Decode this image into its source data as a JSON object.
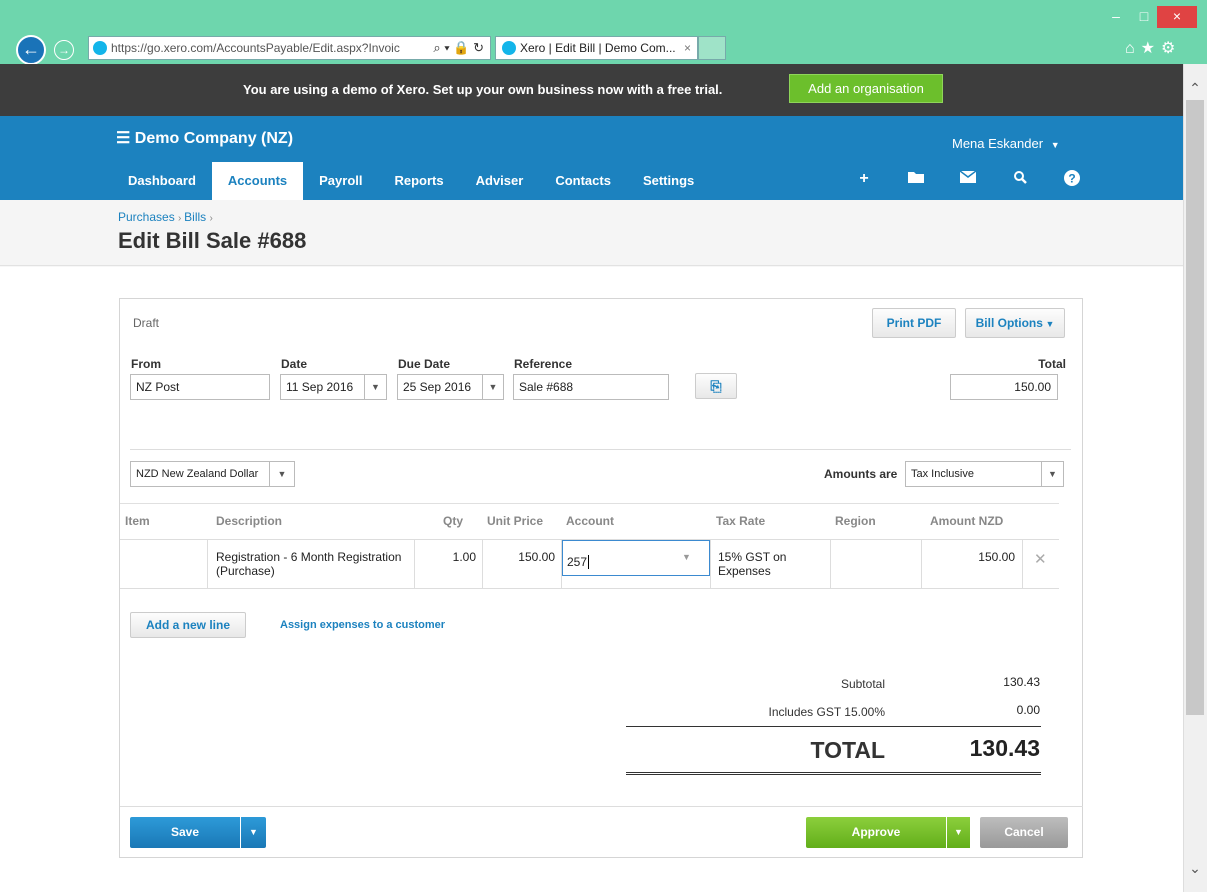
{
  "browser": {
    "url": "https://go.xero.com/AccountsPayable/Edit.aspx?Invoic",
    "tab_title": "Xero | Edit Bill | Demo Com...",
    "tab_close": "×",
    "window_minimize": "–",
    "window_maximize": "□",
    "window_close": "×"
  },
  "banner": {
    "message": "You are using a demo of Xero. Set up your own business now with a free trial.",
    "add_org_label": "Add an organisation"
  },
  "header": {
    "company": "Demo Company (NZ)",
    "user": "Mena Eskander"
  },
  "nav": {
    "items": [
      "Dashboard",
      "Accounts",
      "Payroll",
      "Reports",
      "Adviser",
      "Contacts",
      "Settings"
    ],
    "active": "Accounts",
    "icons": [
      "plus-icon",
      "folder-icon",
      "mail-icon",
      "search-icon",
      "help-icon"
    ]
  },
  "page": {
    "breadcrumb": [
      "Purchases",
      "Bills"
    ],
    "title": "Edit Bill Sale #688"
  },
  "bill": {
    "status": "Draft",
    "print_pdf_label": "Print PDF",
    "bill_options_label": "Bill Options",
    "from_label": "From",
    "from_value": "NZ Post",
    "date_label": "Date",
    "date_value": "11 Sep 2016",
    "due_date_label": "Due Date",
    "due_date_value": "25 Sep 2016",
    "reference_label": "Reference",
    "reference_value": "Sale #688",
    "total_label": "Total",
    "total_value": "150.00",
    "currency_value": "NZD New Zealand Dollar",
    "amounts_are_label": "Amounts are",
    "amounts_are_value": "Tax Inclusive"
  },
  "table": {
    "columns": [
      "Item",
      "Description",
      "Qty",
      "Unit Price",
      "Account",
      "Tax Rate",
      "Region",
      "Amount NZD"
    ],
    "row": {
      "item": "",
      "description_line1": "Registration - 6 Month Registration",
      "description_line2": "(Purchase)",
      "qty": "1.00",
      "unit_price": "150.00",
      "account": "257",
      "tax_rate_line1": "15% GST on",
      "tax_rate_line2": "Expenses",
      "region": "",
      "amount": "150.00"
    },
    "add_line_label": "Add a new line",
    "assign_label": "Assign expenses to a customer"
  },
  "totals": {
    "subtotal_label": "Subtotal",
    "subtotal_value": "130.43",
    "gst_label": "Includes GST 15.00%",
    "gst_value": "0.00",
    "total_label": "TOTAL",
    "total_value": "130.43"
  },
  "actions": {
    "save_label": "Save",
    "approve_label": "Approve",
    "cancel_label": "Cancel"
  },
  "colors": {
    "chrome": "#6ed6ad",
    "header_blue": "#1c82bf",
    "banner": "#3d3d3d",
    "green": "#6cbf2c"
  }
}
